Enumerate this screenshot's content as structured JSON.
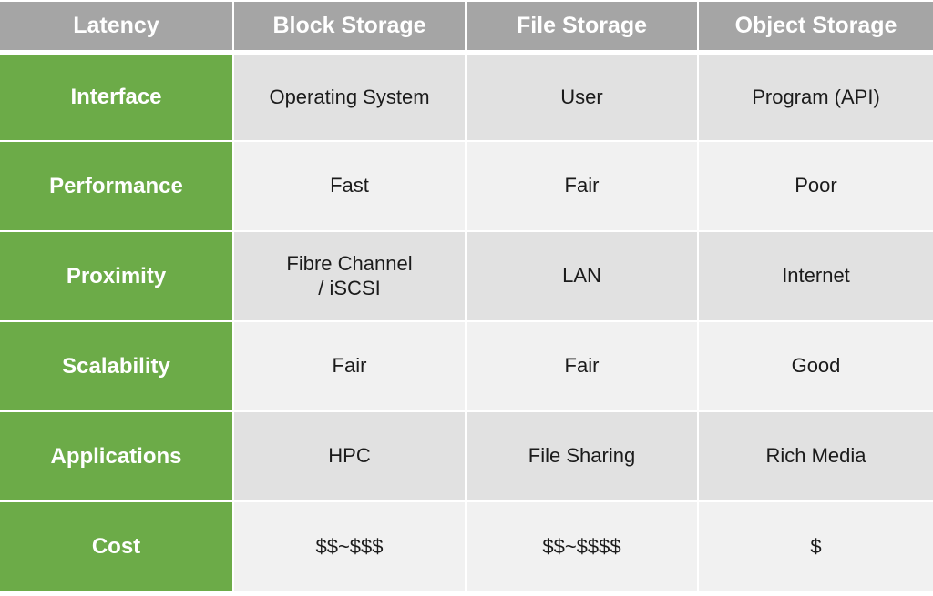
{
  "table": {
    "headers": [
      "Latency",
      "Block Storage",
      "File Storage",
      "Object Storage"
    ],
    "rows": [
      {
        "label": "Interface",
        "values": [
          "Operating System",
          "User",
          "Program (API)"
        ]
      },
      {
        "label": "Performance",
        "values": [
          "Fast",
          "Fair",
          "Poor"
        ]
      },
      {
        "label": "Proximity",
        "values": [
          "Fibre Channel / iSCSI",
          "LAN",
          "Internet"
        ]
      },
      {
        "label": "Scalability",
        "values": [
          "Fair",
          "Fair",
          "Good"
        ]
      },
      {
        "label": "Applications",
        "values": [
          "HPC",
          "File Sharing",
          "Rich Media"
        ]
      },
      {
        "label": "Cost",
        "values": [
          "$$~$$$",
          "$$~$$$$",
          "$"
        ]
      }
    ]
  },
  "colors": {
    "header_bg": "#a5a5a5",
    "row_label_bg": "#6cab48",
    "row_odd_bg": "#e1e1e1",
    "row_even_bg": "#f1f1f1",
    "text_dark": "#1b1b1b",
    "text_light": "#ffffff"
  }
}
